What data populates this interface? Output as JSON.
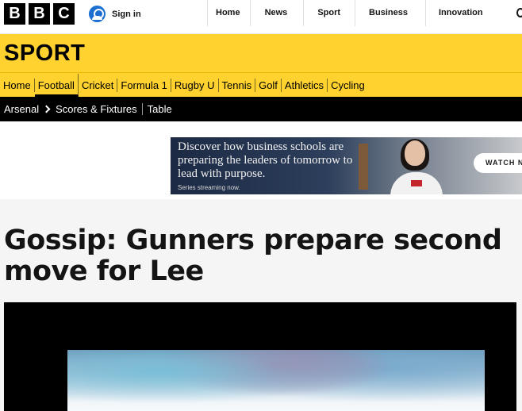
{
  "global_nav": {
    "logo_letters": [
      "B",
      "B",
      "C"
    ],
    "sign_in_label": "Sign in",
    "links": [
      "Home",
      "News",
      "Sport",
      "Business",
      "Innovation"
    ]
  },
  "sport": {
    "title": "SPORT",
    "nav": [
      "Home",
      "Football",
      "Cricket",
      "Formula 1",
      "Rugby U",
      "Tennis",
      "Golf",
      "Athletics",
      "Cycling"
    ],
    "active_nav": "Football"
  },
  "sub_nav": {
    "crumb": "Arsenal",
    "links": [
      "Scores & Fixtures",
      "Table"
    ]
  },
  "ad": {
    "headline": "Discover how business schools are preparing the leaders of tomorrow to lead with purpose.",
    "small_print": "Series streaming now.",
    "button_label": "WATCH N"
  },
  "article": {
    "headline": "Gossip: Gunners prepare second move for Lee"
  },
  "colors": {
    "sport_yellow": "#ffd230",
    "sub_nav_black": "#000000",
    "sign_in_blue": "#1a6fd1",
    "article_bg": "#f5f5f5"
  }
}
